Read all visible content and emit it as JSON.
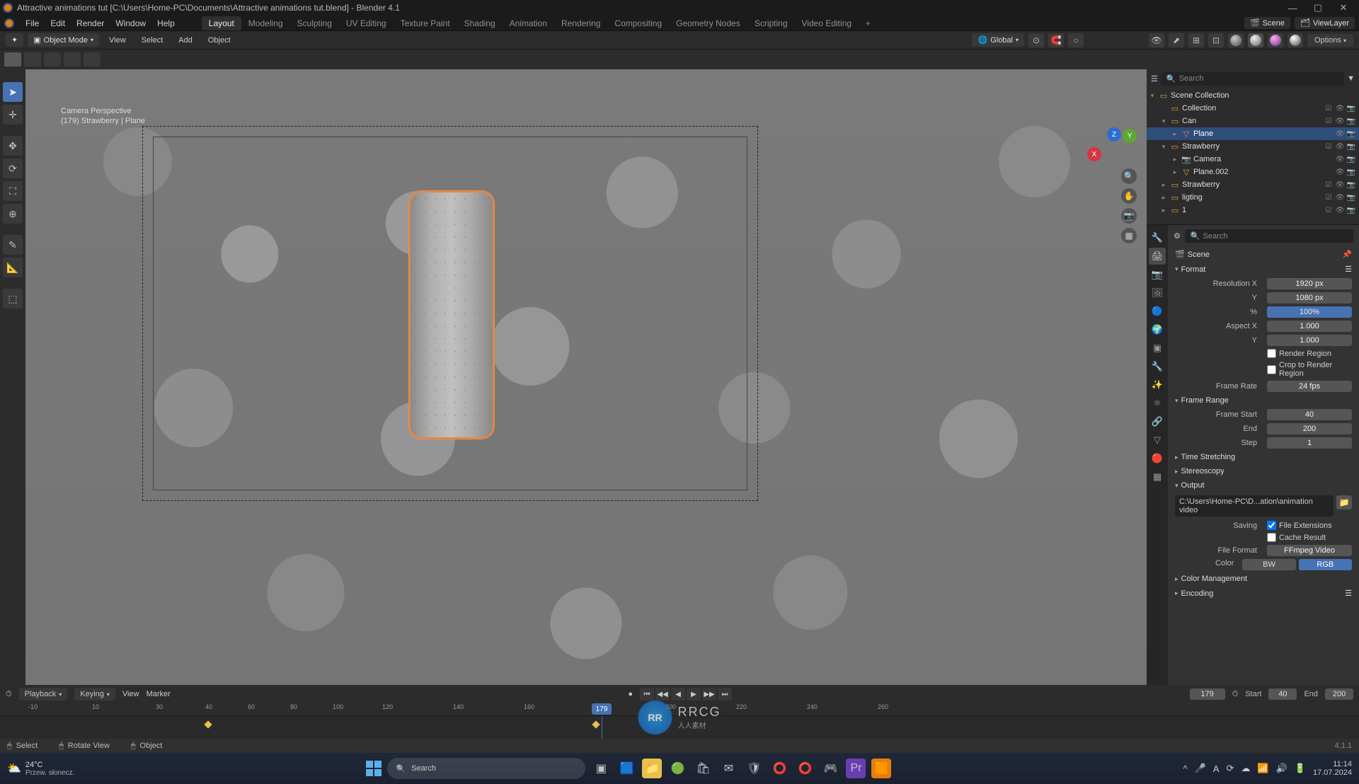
{
  "window": {
    "title": "Attractive animations tut [C:\\Users\\Home-PC\\Documents\\Attractive animations tut.blend] - Blender 4.1"
  },
  "menubar": {
    "items": [
      "File",
      "Edit",
      "Render",
      "Window",
      "Help"
    ],
    "tabs": [
      "Layout",
      "Modeling",
      "Sculpting",
      "UV Editing",
      "Texture Paint",
      "Shading",
      "Animation",
      "Rendering",
      "Compositing",
      "Geometry Nodes",
      "Scripting",
      "Video Editing"
    ],
    "active_tab": 0,
    "scene_label": "Scene",
    "viewlayer_label": "ViewLayer"
  },
  "header": {
    "mode": "Object Mode",
    "menu": [
      "View",
      "Select",
      "Add",
      "Object"
    ],
    "orientation": "Global",
    "options_label": "Options"
  },
  "viewport": {
    "camera_line1": "Camera Perspective",
    "camera_line2": "(179) Strawberry | Plane"
  },
  "outliner": {
    "search_placeholder": "Search",
    "tree": [
      {
        "indent": 0,
        "toggle": "▾",
        "icon": "▭",
        "label": "Scene Collection",
        "selected": false
      },
      {
        "indent": 1,
        "toggle": "",
        "icon": "▭",
        "label": "Collection",
        "selected": false
      },
      {
        "indent": 1,
        "toggle": "▾",
        "icon": "▭",
        "label": "Can",
        "selected": false
      },
      {
        "indent": 2,
        "toggle": "▸",
        "icon": "▽",
        "label": "Plane",
        "selected": true
      },
      {
        "indent": 1,
        "toggle": "▾",
        "icon": "▭",
        "label": "Strawberry",
        "selected": false
      },
      {
        "indent": 2,
        "toggle": "▸",
        "icon": "📷",
        "label": "Camera",
        "selected": false
      },
      {
        "indent": 2,
        "toggle": "▸",
        "icon": "▽",
        "label": "Plane.002",
        "selected": false
      },
      {
        "indent": 1,
        "toggle": "▸",
        "icon": "▭",
        "label": "Strawberry",
        "selected": false
      },
      {
        "indent": 1,
        "toggle": "▸",
        "icon": "▭",
        "label": "ligting",
        "selected": false
      },
      {
        "indent": 1,
        "toggle": "▸",
        "icon": "▭",
        "label": "1",
        "selected": false
      }
    ]
  },
  "properties": {
    "search_placeholder": "Search",
    "scene_label": "Scene",
    "format": {
      "title": "Format",
      "res_x_label": "Resolution X",
      "res_x": "1920 px",
      "res_y_label": "Y",
      "res_y": "1080 px",
      "pct_label": "%",
      "pct": "100%",
      "aspect_x_label": "Aspect X",
      "aspect_x": "1.000",
      "aspect_y_label": "Y",
      "aspect_y": "1.000",
      "render_region": "Render Region",
      "crop_region": "Crop to Render Region",
      "framerate_label": "Frame Rate",
      "framerate": "24 fps"
    },
    "frame_range": {
      "title": "Frame Range",
      "start_label": "Frame Start",
      "start": "40",
      "end_label": "End",
      "end": "200",
      "step_label": "Step",
      "step": "1"
    },
    "time_stretching": "Time Stretching",
    "stereoscopy": "Stereoscopy",
    "output": {
      "title": "Output",
      "path": "C:\\Users\\Home-PC\\D...ation\\animation video",
      "saving_label": "Saving",
      "file_ext": "File Extensions",
      "cache_result": "Cache Result",
      "format_label": "File Format",
      "format": "FFmpeg Video",
      "color_label": "Color",
      "bw": "BW",
      "rgb": "RGB"
    },
    "color_mgmt": "Color Management",
    "encoding": "Encoding"
  },
  "timeline": {
    "playback": "Playback",
    "keying": "Keying",
    "view": "View",
    "marker": "Marker",
    "current_frame": "179",
    "start_label": "Start",
    "start": "40",
    "end_label": "End",
    "end": "200",
    "ticks": [
      "40",
      "60",
      "80",
      "100",
      "120",
      "140",
      "160",
      "180",
      "200",
      "220",
      "240",
      "260"
    ],
    "sub_ticks_left": [
      "-10",
      "10",
      "30"
    ],
    "playhead": "179",
    "status_select": "Select",
    "status_rotate": "Rotate View",
    "status_object": "Object",
    "version": "4.1.1"
  },
  "taskbar": {
    "temp": "24°C",
    "weather_desc": "Przew. słonecz.",
    "search_placeholder": "Search",
    "time": "11:14",
    "date": "17.07.2024"
  },
  "watermark": {
    "main": "RRCG",
    "sub": "人人素材"
  }
}
